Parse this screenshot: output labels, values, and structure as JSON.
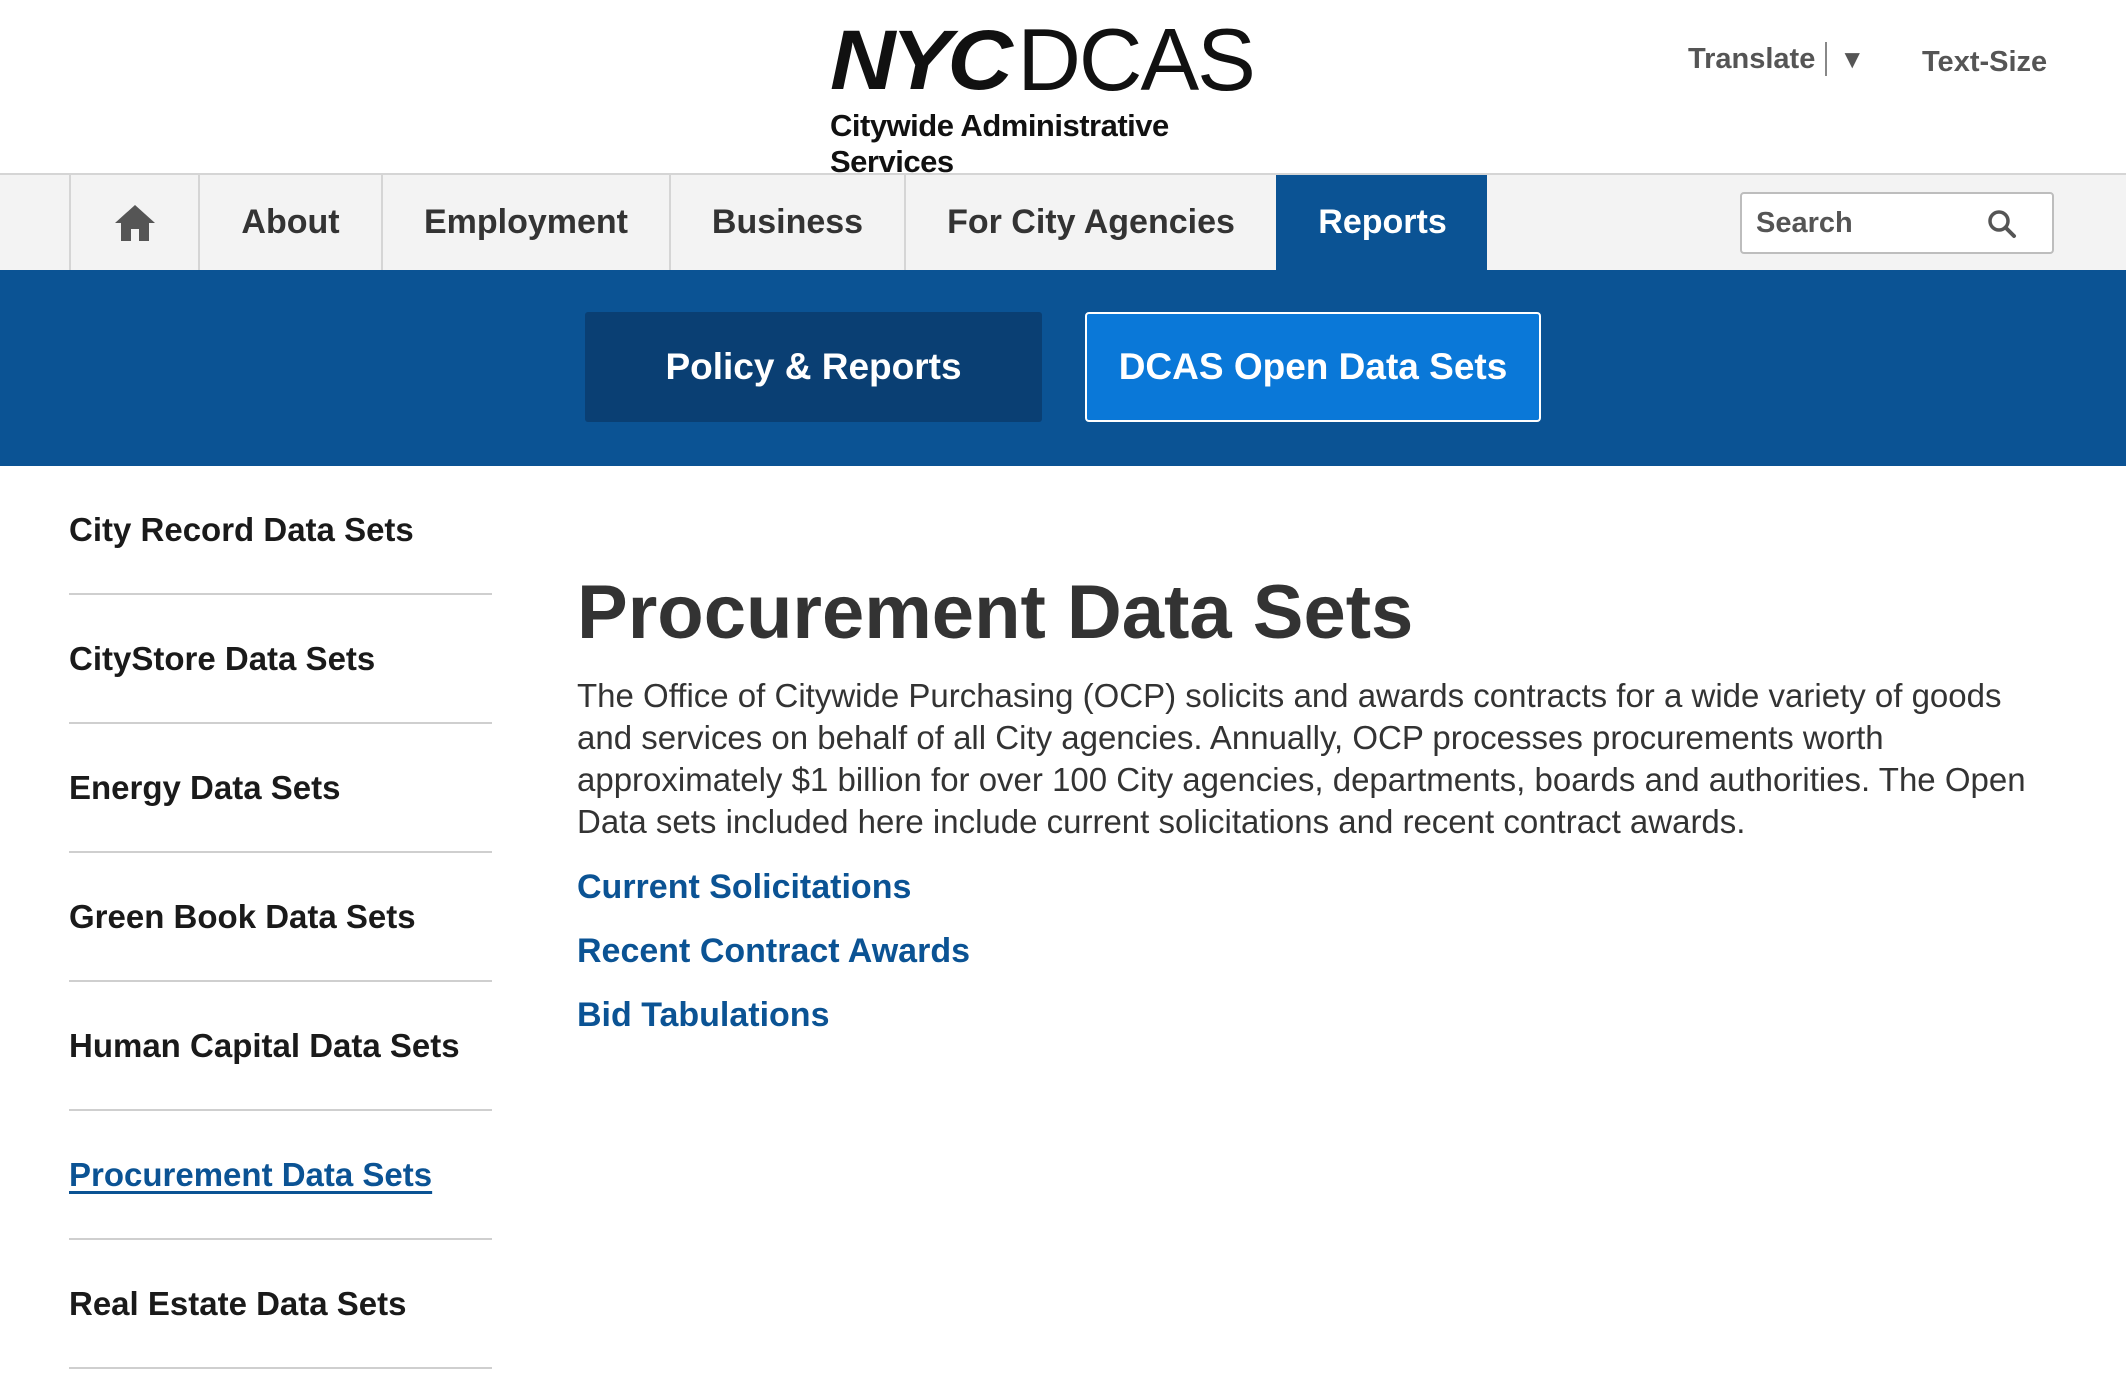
{
  "header": {
    "logo_nyc": "NYC",
    "logo_dcas": "DCAS",
    "logo_sub": "Citywide Administrative Services",
    "translate": "Translate",
    "translate_caret": "▼",
    "text_size": "Text-Size"
  },
  "nav": {
    "items": [
      {
        "label": "About"
      },
      {
        "label": "Employment"
      },
      {
        "label": "Business"
      },
      {
        "label": "For City Agencies"
      },
      {
        "label": "Reports"
      }
    ],
    "active": "Reports",
    "search_placeholder": "Search"
  },
  "subnav": {
    "policy": "Policy & Reports",
    "open_data": "DCAS Open Data Sets"
  },
  "sidebar": {
    "items": [
      {
        "label": "City Record Data Sets"
      },
      {
        "label": "CityStore Data Sets"
      },
      {
        "label": "Energy Data Sets"
      },
      {
        "label": "Green Book Data Sets"
      },
      {
        "label": "Human Capital Data Sets"
      },
      {
        "label": "Procurement Data Sets"
      },
      {
        "label": "Real Estate Data Sets"
      }
    ],
    "active": "Procurement Data Sets"
  },
  "main": {
    "title": "Procurement Data Sets",
    "intro": "The Office of Citywide Purchasing (OCP) solicits and awards contracts for a wide variety of goods and services on behalf of all City agencies. Annually, OCP processes procurements worth approximately $1 billion for over 100 City agencies, departments, boards and authorities. The Open Data sets included here include current solicitations and recent contract awards.",
    "links": [
      {
        "label": "Current Solicitations"
      },
      {
        "label": "Recent Contract Awards"
      },
      {
        "label": "Bid Tabulations"
      }
    ]
  },
  "colors": {
    "primary_blue": "#0b5394",
    "active_button": "#0a78d8",
    "dark_button": "#0a3f73",
    "nav_bg": "#f3f3f3"
  }
}
